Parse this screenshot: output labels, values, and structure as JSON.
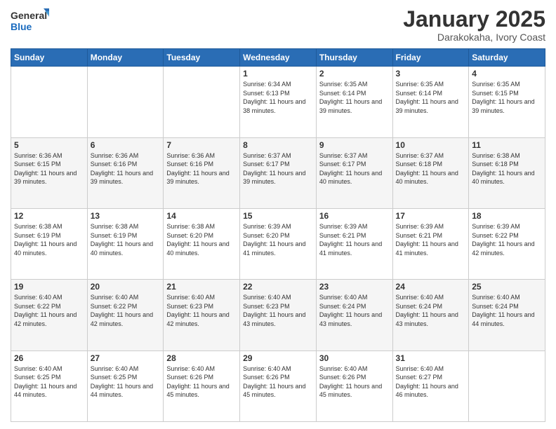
{
  "header": {
    "logo_text_general": "General",
    "logo_text_blue": "Blue",
    "month_title": "January 2025",
    "location": "Darakokaha, Ivory Coast"
  },
  "days_of_week": [
    "Sunday",
    "Monday",
    "Tuesday",
    "Wednesday",
    "Thursday",
    "Friday",
    "Saturday"
  ],
  "weeks": [
    [
      {
        "day": "",
        "info": ""
      },
      {
        "day": "",
        "info": ""
      },
      {
        "day": "",
        "info": ""
      },
      {
        "day": "1",
        "info": "Sunrise: 6:34 AM\nSunset: 6:13 PM\nDaylight: 11 hours and 38 minutes."
      },
      {
        "day": "2",
        "info": "Sunrise: 6:35 AM\nSunset: 6:14 PM\nDaylight: 11 hours and 39 minutes."
      },
      {
        "day": "3",
        "info": "Sunrise: 6:35 AM\nSunset: 6:14 PM\nDaylight: 11 hours and 39 minutes."
      },
      {
        "day": "4",
        "info": "Sunrise: 6:35 AM\nSunset: 6:15 PM\nDaylight: 11 hours and 39 minutes."
      }
    ],
    [
      {
        "day": "5",
        "info": "Sunrise: 6:36 AM\nSunset: 6:15 PM\nDaylight: 11 hours and 39 minutes."
      },
      {
        "day": "6",
        "info": "Sunrise: 6:36 AM\nSunset: 6:16 PM\nDaylight: 11 hours and 39 minutes."
      },
      {
        "day": "7",
        "info": "Sunrise: 6:36 AM\nSunset: 6:16 PM\nDaylight: 11 hours and 39 minutes."
      },
      {
        "day": "8",
        "info": "Sunrise: 6:37 AM\nSunset: 6:17 PM\nDaylight: 11 hours and 39 minutes."
      },
      {
        "day": "9",
        "info": "Sunrise: 6:37 AM\nSunset: 6:17 PM\nDaylight: 11 hours and 40 minutes."
      },
      {
        "day": "10",
        "info": "Sunrise: 6:37 AM\nSunset: 6:18 PM\nDaylight: 11 hours and 40 minutes."
      },
      {
        "day": "11",
        "info": "Sunrise: 6:38 AM\nSunset: 6:18 PM\nDaylight: 11 hours and 40 minutes."
      }
    ],
    [
      {
        "day": "12",
        "info": "Sunrise: 6:38 AM\nSunset: 6:19 PM\nDaylight: 11 hours and 40 minutes."
      },
      {
        "day": "13",
        "info": "Sunrise: 6:38 AM\nSunset: 6:19 PM\nDaylight: 11 hours and 40 minutes."
      },
      {
        "day": "14",
        "info": "Sunrise: 6:38 AM\nSunset: 6:20 PM\nDaylight: 11 hours and 40 minutes."
      },
      {
        "day": "15",
        "info": "Sunrise: 6:39 AM\nSunset: 6:20 PM\nDaylight: 11 hours and 41 minutes."
      },
      {
        "day": "16",
        "info": "Sunrise: 6:39 AM\nSunset: 6:21 PM\nDaylight: 11 hours and 41 minutes."
      },
      {
        "day": "17",
        "info": "Sunrise: 6:39 AM\nSunset: 6:21 PM\nDaylight: 11 hours and 41 minutes."
      },
      {
        "day": "18",
        "info": "Sunrise: 6:39 AM\nSunset: 6:22 PM\nDaylight: 11 hours and 42 minutes."
      }
    ],
    [
      {
        "day": "19",
        "info": "Sunrise: 6:40 AM\nSunset: 6:22 PM\nDaylight: 11 hours and 42 minutes."
      },
      {
        "day": "20",
        "info": "Sunrise: 6:40 AM\nSunset: 6:22 PM\nDaylight: 11 hours and 42 minutes."
      },
      {
        "day": "21",
        "info": "Sunrise: 6:40 AM\nSunset: 6:23 PM\nDaylight: 11 hours and 42 minutes."
      },
      {
        "day": "22",
        "info": "Sunrise: 6:40 AM\nSunset: 6:23 PM\nDaylight: 11 hours and 43 minutes."
      },
      {
        "day": "23",
        "info": "Sunrise: 6:40 AM\nSunset: 6:24 PM\nDaylight: 11 hours and 43 minutes."
      },
      {
        "day": "24",
        "info": "Sunrise: 6:40 AM\nSunset: 6:24 PM\nDaylight: 11 hours and 43 minutes."
      },
      {
        "day": "25",
        "info": "Sunrise: 6:40 AM\nSunset: 6:24 PM\nDaylight: 11 hours and 44 minutes."
      }
    ],
    [
      {
        "day": "26",
        "info": "Sunrise: 6:40 AM\nSunset: 6:25 PM\nDaylight: 11 hours and 44 minutes."
      },
      {
        "day": "27",
        "info": "Sunrise: 6:40 AM\nSunset: 6:25 PM\nDaylight: 11 hours and 44 minutes."
      },
      {
        "day": "28",
        "info": "Sunrise: 6:40 AM\nSunset: 6:26 PM\nDaylight: 11 hours and 45 minutes."
      },
      {
        "day": "29",
        "info": "Sunrise: 6:40 AM\nSunset: 6:26 PM\nDaylight: 11 hours and 45 minutes."
      },
      {
        "day": "30",
        "info": "Sunrise: 6:40 AM\nSunset: 6:26 PM\nDaylight: 11 hours and 45 minutes."
      },
      {
        "day": "31",
        "info": "Sunrise: 6:40 AM\nSunset: 6:27 PM\nDaylight: 11 hours and 46 minutes."
      },
      {
        "day": "",
        "info": ""
      }
    ]
  ]
}
